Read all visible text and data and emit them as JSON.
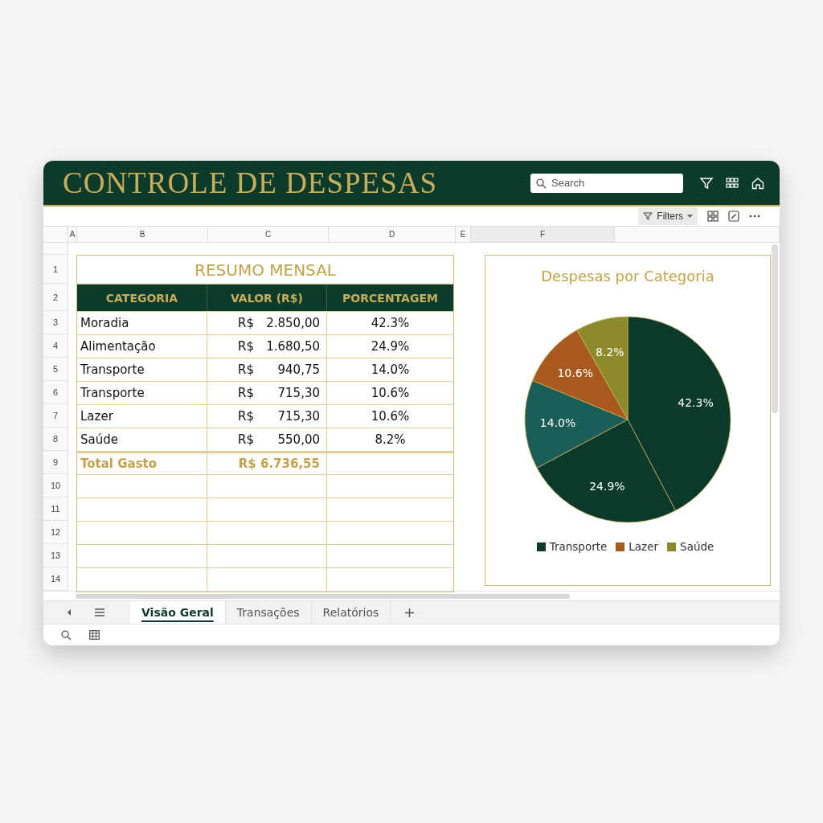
{
  "header": {
    "title": "CONTROLE DE DESPESAS",
    "search": {
      "placeholder": "Search"
    }
  },
  "toolbar": {
    "filters": "Filters"
  },
  "columns": [
    "A",
    "B",
    "C",
    "D",
    "E",
    "F"
  ],
  "row_numbers": [
    "1",
    "2",
    "3",
    "4",
    "5",
    "6",
    "7",
    "8",
    "9",
    "10",
    "11",
    "12",
    "13",
    "14"
  ],
  "summary": {
    "title": "RESUMO MENSAL",
    "headers": [
      "CATEGORIA",
      "VALOR (R$)",
      "PORCENTAGEM"
    ],
    "rows": [
      {
        "category": "Moradia",
        "currency": "R$",
        "amount": "2.850,00",
        "percent": "42.3%"
      },
      {
        "category": "Alimentação",
        "currency": "R$",
        "amount": "1.680,50",
        "percent": "24.9%"
      },
      {
        "category": "Transporte",
        "currency": "R$",
        "amount": "940,75",
        "percent": "14.0%"
      },
      {
        "category": "Transporte",
        "currency": "R$",
        "amount": "715,30",
        "percent": "10.6%"
      },
      {
        "category": "Lazer",
        "currency": "R$",
        "amount": "715,30",
        "percent": "10.6%"
      },
      {
        "category": "Saúde",
        "currency": "R$",
        "amount": "550,00",
        "percent": "8.2%"
      }
    ],
    "total": {
      "label": "Total Gasto",
      "value": "R$ 6.736,55"
    }
  },
  "chart": {
    "chart_data": {
      "type": "pie",
      "title": "Despesas por Categoria",
      "values": [
        42.3,
        24.9,
        14.0,
        10.6,
        8.2
      ],
      "data_labels": true,
      "value_labels": [
        "42.3%",
        "24.9%",
        "14.0%",
        "10.6%",
        "8.2%"
      ]
    },
    "slices": [
      {
        "color": "#0b3a2c"
      },
      {
        "color": "#0b3a2c"
      },
      {
        "color": "#1b5e58"
      },
      {
        "color": "#a85a1e"
      },
      {
        "color": "#8c8a2a"
      }
    ],
    "legend": [
      {
        "label": "Transporte",
        "color": "#0b3a2c"
      },
      {
        "label": "Lazer",
        "color": "#a85a1e"
      },
      {
        "label": "Saúde",
        "color": "#8c8a2a"
      }
    ]
  },
  "sheet_tabs": [
    {
      "label": "Visão Geral",
      "selected": true
    },
    {
      "label": "Transações",
      "selected": false
    },
    {
      "label": "Relatórios",
      "selected": false
    }
  ]
}
